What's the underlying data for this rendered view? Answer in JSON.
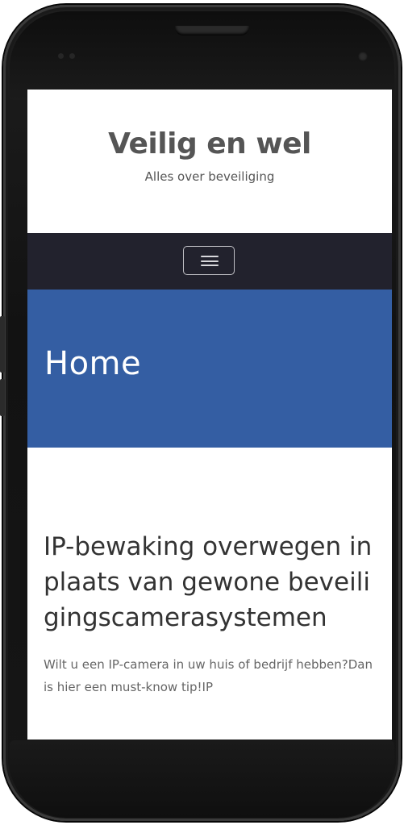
{
  "site": {
    "title": "Veilig en wel",
    "tagline": "Alles over beveiliging"
  },
  "nav": {
    "toggle_icon": "hamburger-menu-icon"
  },
  "banner": {
    "title": "Home"
  },
  "post": {
    "title": "IP-bewaking overwegen in plaats van gewone beveiligingscamerasystemen",
    "excerpt": "Wilt u een IP-camera in uw huis of bedrijf hebben?Dan is hier een must-know tip!IP"
  },
  "colors": {
    "nav_background": "#22222d",
    "banner_background": "#345ea3",
    "title_text": "#555555",
    "frame": "#161616"
  }
}
